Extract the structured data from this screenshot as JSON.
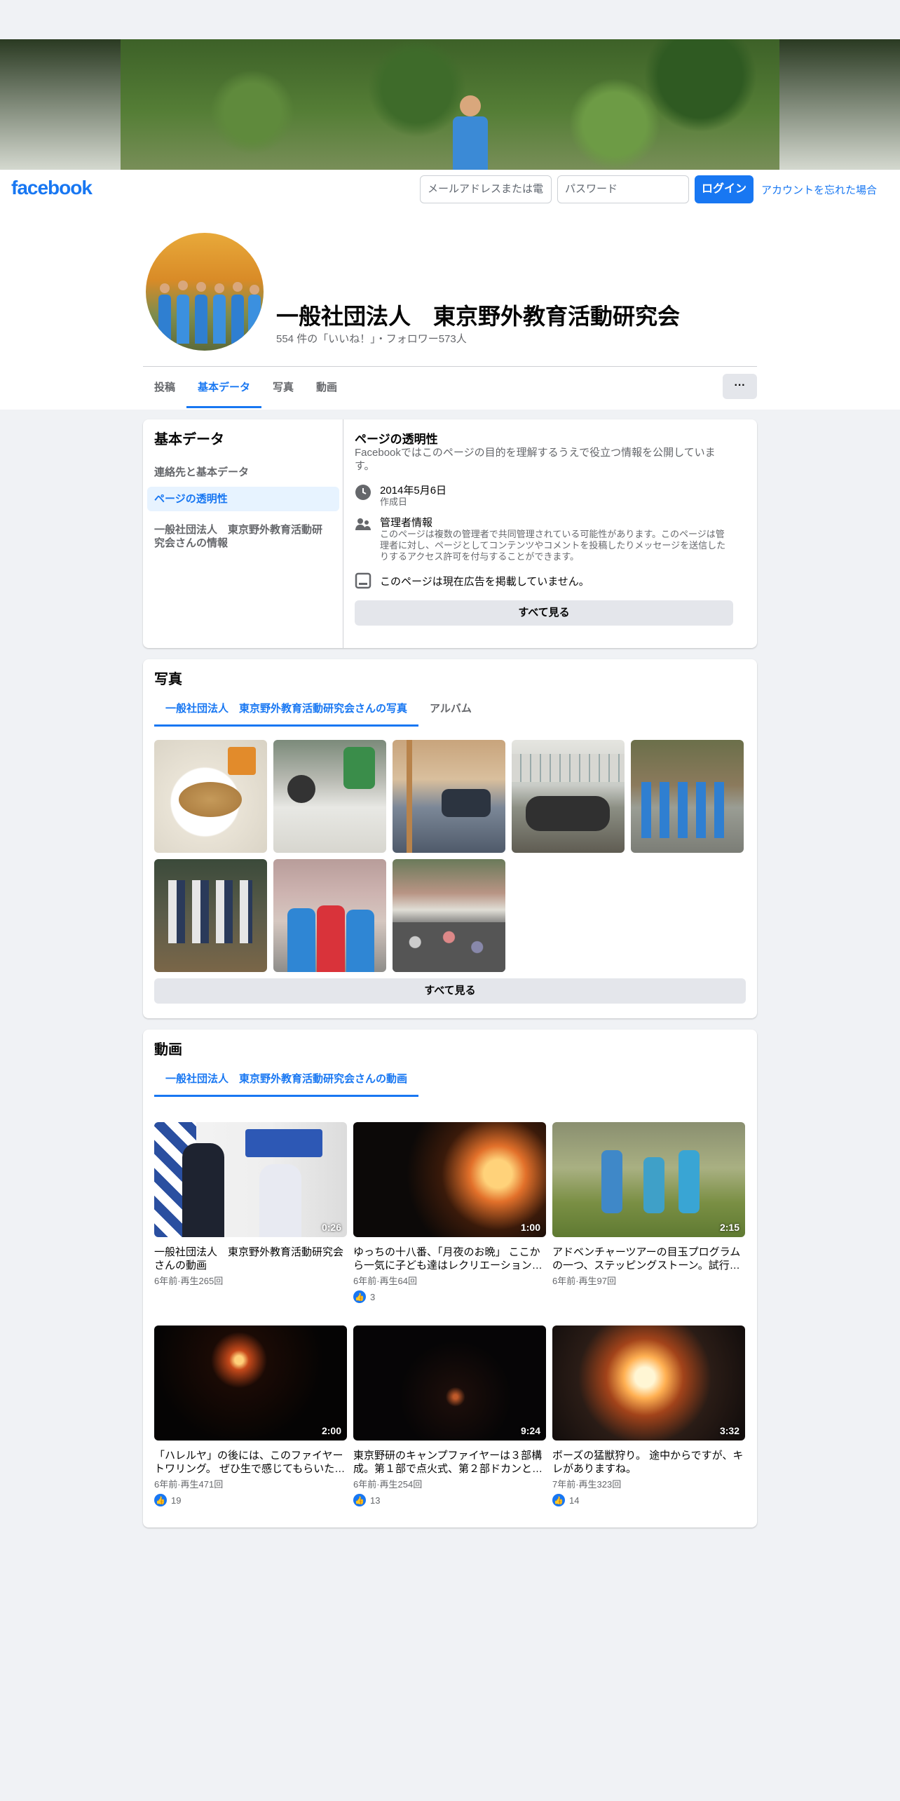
{
  "header": {
    "logo": "facebook",
    "email_placeholder": "メールアドレスまたは電",
    "password_placeholder": "パスワード",
    "login_label": "ログイン",
    "forgot_label": "アカウントを忘れた場合"
  },
  "profile": {
    "name": "一般社団法人　東京野外教育活動研究会",
    "stats": "554 件の「いいね！」・フォロワー573人",
    "tabs": [
      "投稿",
      "基本データ",
      "写真",
      "動画"
    ],
    "more_label": "···"
  },
  "about": {
    "title": "基本データ",
    "menu": [
      "連絡先と基本データ",
      "ページの透明性",
      "一般社団法人　東京野外教育活動研究会さんの情報"
    ],
    "transparency_title": "ページの透明性",
    "transparency_desc": "Facebookではこのページの目的を理解するうえで役立つ情報を公開しています。",
    "created_date": "2014年5月6日",
    "created_label": "作成日",
    "admin_title": "管理者情報",
    "admin_desc": "このページは複数の管理者で共同管理されている可能性があります。このページは管理者に対し、ページとしてコンテンツやコメントを投稿したりメッセージを送信したりするアクセス許可を付与することができます。",
    "ads_text": "このページは現在広告を掲載していません。",
    "see_all": "すべて見る"
  },
  "photos": {
    "title": "写真",
    "tabs": [
      "一般社団法人　東京野外教育活動研究会さんの写真",
      "アルバム"
    ],
    "see_all": "すべて見る"
  },
  "videos": {
    "title": "動画",
    "tab": "一般社団法人　東京野外教育活動研究会さんの動画",
    "items": [
      {
        "duration": "0:26",
        "title": "一般社団法人　東京野外教育活動研究会さんの動画",
        "meta": "6年前·再生265回",
        "likes": ""
      },
      {
        "duration": "1:00",
        "title": "ゆっちの十八番、「月夜のお晩」 ここから一気に子ども達はレクリエーション…",
        "meta": "6年前·再生64回",
        "likes": "3"
      },
      {
        "duration": "2:15",
        "title": "アドベンチャーツアーの目玉プログラムの一つ、ステッピングストーン。試行…",
        "meta": "6年前·再生97回",
        "likes": ""
      },
      {
        "duration": "2:00",
        "title": "「ハレルヤ」の後には、このファイヤートワリング。 ぜひ生で感じてもらいた…",
        "meta": "6年前·再生471回",
        "likes": "19"
      },
      {
        "duration": "9:24",
        "title": "東京野研のキャンプファイヤーは３部構成。第１部で点火式、第２部ドカンと…",
        "meta": "6年前·再生254回",
        "likes": "13"
      },
      {
        "duration": "3:32",
        "title": "ボーズの猛獣狩り。 途中からですが、キレがありますね。",
        "meta": "7年前·再生323回",
        "likes": "14"
      }
    ]
  },
  "colors": {
    "accent": "#1877f2",
    "background": "#f0f2f5"
  }
}
